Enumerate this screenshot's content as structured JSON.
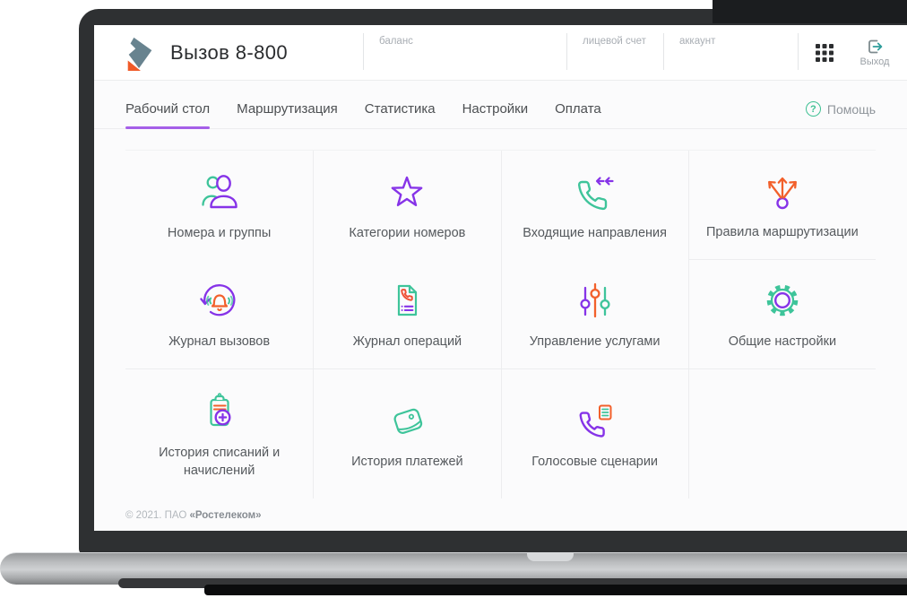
{
  "header": {
    "brand_title": "Вызов 8-800",
    "logo_icon": "rostelecom-flag-icon",
    "fields": [
      {
        "label": "баланс",
        "value": ""
      },
      {
        "label": "лицевой счет",
        "value": ""
      },
      {
        "label": "аккаунт",
        "value": ""
      }
    ],
    "apps_icon": "apps-grid-icon",
    "logout": {
      "label": "Выход",
      "icon": "logout-icon"
    }
  },
  "nav": {
    "tabs": [
      {
        "label": "Рабочий стол",
        "active": true
      },
      {
        "label": "Маршрутизация",
        "active": false
      },
      {
        "label": "Статистика",
        "active": false
      },
      {
        "label": "Настройки",
        "active": false
      },
      {
        "label": "Оплата",
        "active": false
      }
    ],
    "help": {
      "label": "Помощь",
      "icon_glyph": "?"
    }
  },
  "tiles": [
    {
      "label": "Номера и группы",
      "icon": "users-icon"
    },
    {
      "label": "Категории номеров",
      "icon": "star-icon"
    },
    {
      "label": "Входящие направления",
      "icon": "incoming-call-icon"
    },
    {
      "label": "Правила маршрутизации",
      "icon": "routing-arrows-icon"
    },
    {
      "label": "Журнал вызовов",
      "icon": "bell-refresh-icon"
    },
    {
      "label": "Журнал операций",
      "icon": "call-document-icon"
    },
    {
      "label": "Управление услугами",
      "icon": "sliders-icon"
    },
    {
      "label": "Общие настройки",
      "icon": "gear-icon"
    },
    {
      "label": "История списаний и начислений",
      "icon": "clipboard-plus-icon"
    },
    {
      "label": "История платежей",
      "icon": "wallet-icon"
    },
    {
      "label": "Голосовые сценарии",
      "icon": "voice-script-icon"
    }
  ],
  "footer": {
    "copyright_prefix": "© 2021. ПАО ",
    "copyright_brand": "«Ростелеком»"
  },
  "colors": {
    "accent_purple": "#8633e8",
    "accent_green": "#3ec49a",
    "accent_orange": "#f2602b",
    "accent_red": "#ee5238",
    "tab_underline": "#a55fe8",
    "brand_gray_blue": "#68838f",
    "brand_orange": "#f05a28",
    "text_dark": "#2b2d2f",
    "text_muted": "#9aa0a6"
  }
}
